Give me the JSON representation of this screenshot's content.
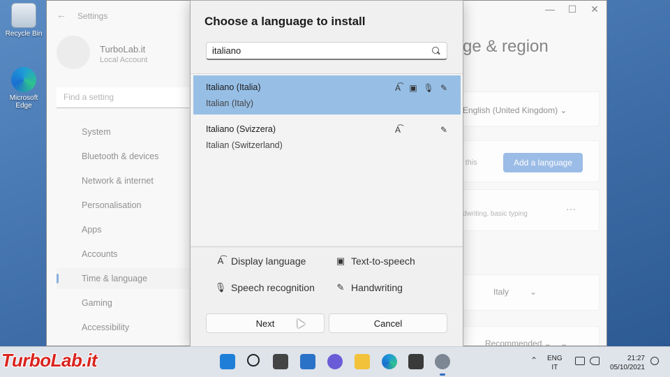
{
  "desktop": {
    "icons": [
      {
        "label": "Recycle Bin"
      },
      {
        "label": "Microsoft Edge"
      }
    ]
  },
  "settings": {
    "title": "Settings",
    "user_name": "TurboLab.it",
    "user_sub": "Local Account",
    "search_placeholder": "Find a setting",
    "nav": [
      {
        "label": "System",
        "color": "#4a8fd6"
      },
      {
        "label": "Bluetooth & devices",
        "color": "#2e86d1"
      },
      {
        "label": "Network & internet",
        "color": "#3aa0d8"
      },
      {
        "label": "Personalisation",
        "color": "#d28b3a"
      },
      {
        "label": "Apps",
        "color": "#6c7a8a"
      },
      {
        "label": "Accounts",
        "color": "#3fb08a"
      },
      {
        "label": "Time & language",
        "color": "#3a8fd1",
        "active": true
      },
      {
        "label": "Gaming",
        "color": "#8a8a8a"
      },
      {
        "label": "Accessibility",
        "color": "#2f7fc9"
      }
    ],
    "heading": "ge & region",
    "display_language": "English (United Kingdom)",
    "add_language_label": "Add a language",
    "card_hint": "in this",
    "card_features": "dwriting, basic typing",
    "region_value": "Italy",
    "format_value": "Recommended"
  },
  "dialog": {
    "title": "Choose a language to install",
    "search_value": "italiano",
    "results": [
      {
        "native": "Italiano (Italia)",
        "english": "Italian (Italy)",
        "selected": true,
        "features": [
          "display-language-icon",
          "text-to-speech-icon",
          "speech-recognition-icon",
          "handwriting-icon"
        ]
      },
      {
        "native": "Italiano (Svizzera)",
        "english": "Italian (Switzerland)",
        "selected": false,
        "features": [
          "display-language-icon",
          "handwriting-icon"
        ]
      }
    ],
    "legend": {
      "display_language": "Display language",
      "text_to_speech": "Text-to-speech",
      "speech_recognition": "Speech recognition",
      "handwriting": "Handwriting"
    },
    "next_label": "Next",
    "cancel_label": "Cancel"
  },
  "taskbar": {
    "watermark": "TurboLab.it",
    "language_line1": "ENG",
    "language_line2": "IT",
    "time": "21:27",
    "date": "05/10/2021"
  }
}
